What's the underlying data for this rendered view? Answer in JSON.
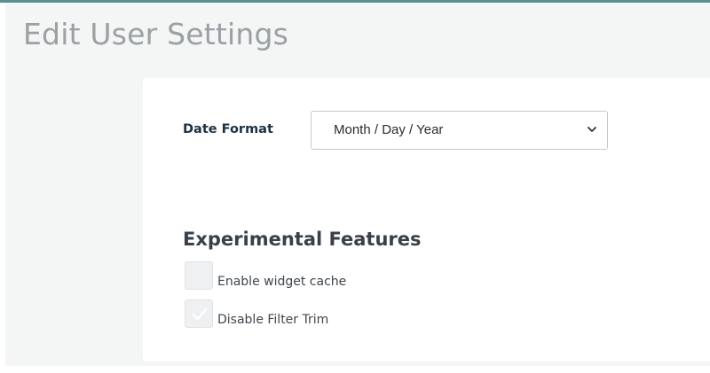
{
  "header": {
    "title": "Edit User Settings",
    "accent_color": "#5c8d91"
  },
  "settings": {
    "date_format": {
      "label": "Date Format",
      "selected": "Month / Day / Year"
    },
    "experimental": {
      "title": "Experimental Features",
      "options": [
        {
          "label": "Enable widget cache",
          "checked": false
        },
        {
          "label": "Disable Filter Trim",
          "checked": true
        }
      ]
    }
  },
  "icons": {
    "select_arrow": "chevron-down-icon",
    "check": "checkmark-icon"
  }
}
